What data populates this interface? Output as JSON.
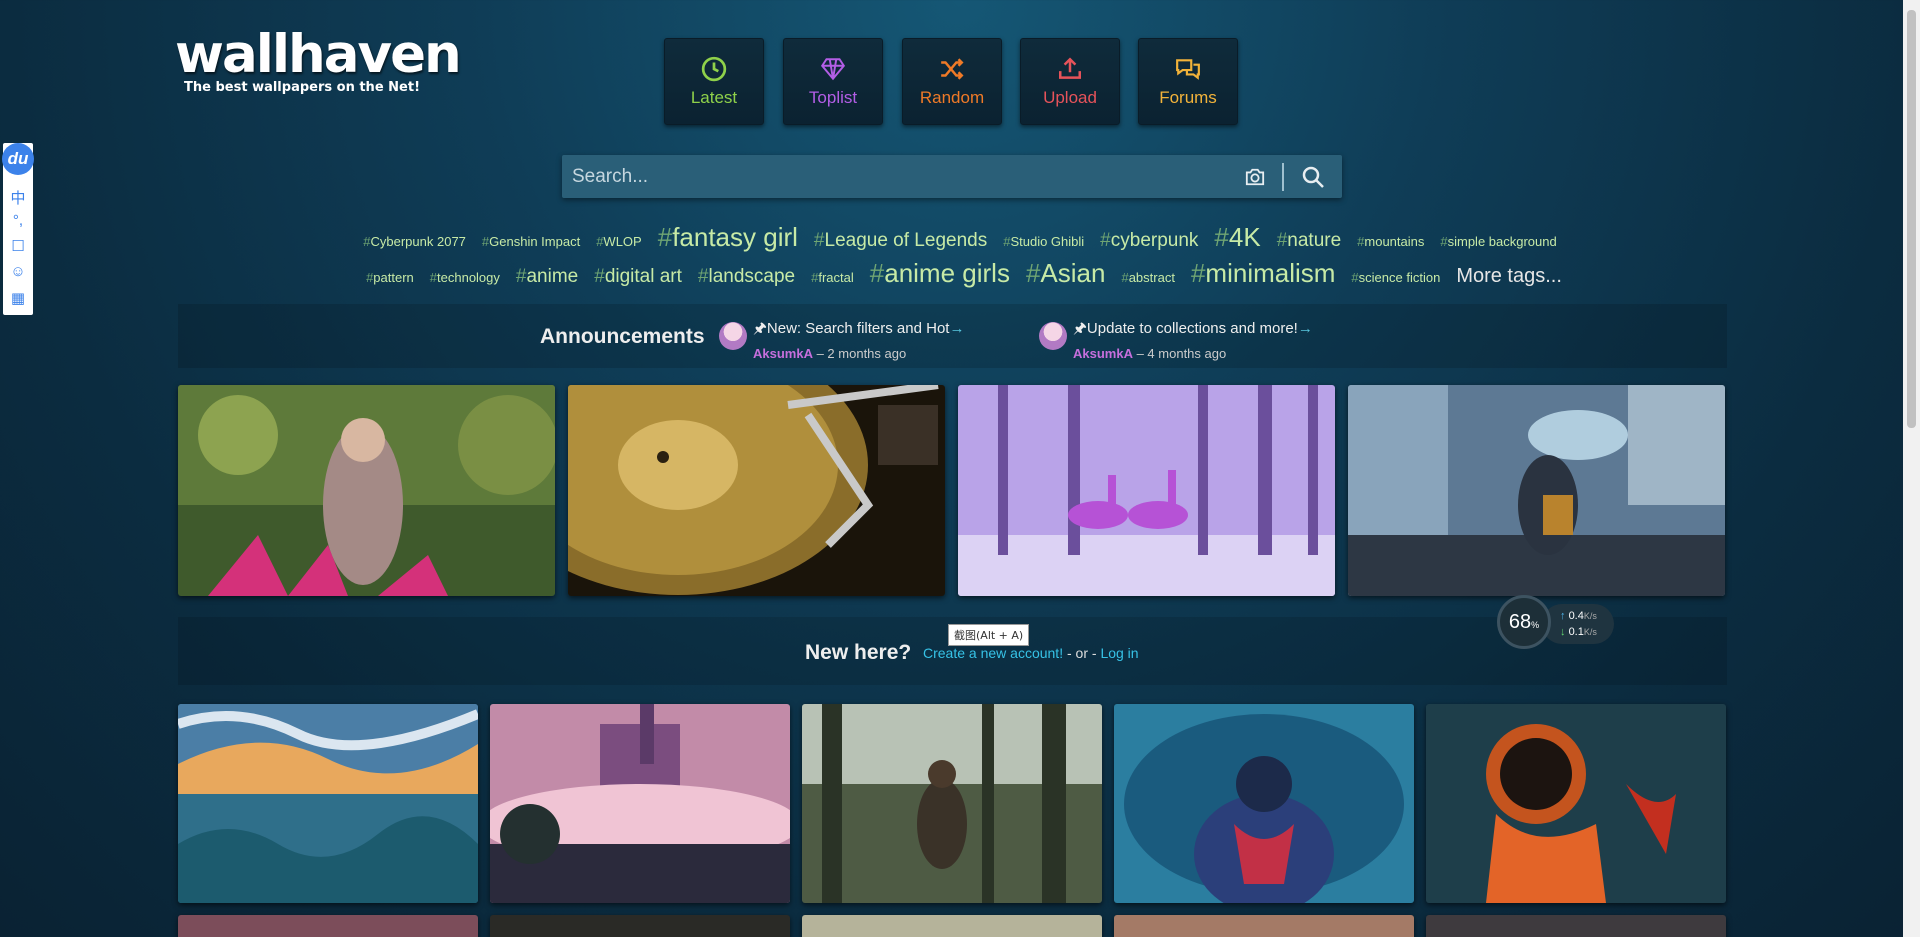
{
  "logo": {
    "title": "wallhaven",
    "tagline": "The best wallpapers on the Net!"
  },
  "nav": [
    {
      "label": "Latest",
      "icon": "clock-icon",
      "color": "#8fd14a"
    },
    {
      "label": "Toplist",
      "icon": "diamond-icon",
      "color": "#b35ee6"
    },
    {
      "label": "Random",
      "icon": "shuffle-icon",
      "color": "#ef7a27"
    },
    {
      "label": "Upload",
      "icon": "upload-icon",
      "color": "#e6535a"
    },
    {
      "label": "Forums",
      "icon": "comments-icon",
      "color": "#f2b33a"
    }
  ],
  "search": {
    "placeholder": "Search..."
  },
  "tags_row1": [
    {
      "name": "Cyberpunk 2077",
      "size": 1
    },
    {
      "name": "Genshin Impact",
      "size": 1
    },
    {
      "name": "WLOP",
      "size": 1
    },
    {
      "name": "fantasy girl",
      "size": 3
    },
    {
      "name": "League of Legends",
      "size": 2
    },
    {
      "name": "Studio Ghibli",
      "size": 1
    },
    {
      "name": "cyberpunk",
      "size": 2
    },
    {
      "name": "4K",
      "size": 3
    },
    {
      "name": "nature",
      "size": 2
    },
    {
      "name": "mountains",
      "size": 1
    },
    {
      "name": "simple background",
      "size": 1
    }
  ],
  "tags_row2": [
    {
      "name": "pattern",
      "size": 1
    },
    {
      "name": "technology",
      "size": 1
    },
    {
      "name": "anime",
      "size": 2
    },
    {
      "name": "digital art",
      "size": 2
    },
    {
      "name": "landscape",
      "size": 2
    },
    {
      "name": "fractal",
      "size": 1
    },
    {
      "name": "anime girls",
      "size": 3
    },
    {
      "name": "Asian",
      "size": 3
    },
    {
      "name": "abstract",
      "size": 1
    },
    {
      "name": "minimalism",
      "size": 3
    },
    {
      "name": "science fiction",
      "size": 1
    }
  ],
  "more_tags": "More tags...",
  "announcements": {
    "title": "Announcements",
    "items": [
      {
        "text": "New: Search filters and Hot",
        "user": "AksumkA",
        "ago": "– 2 months ago"
      },
      {
        "text": "Update to collections and more!",
        "user": "AksumkA",
        "ago": "– 4 months ago"
      }
    ]
  },
  "new_here": {
    "title": "New here?",
    "create": "Create a new account!",
    "or": " - or - ",
    "login": "Log in"
  },
  "tooltip": "截图(Alt + A)",
  "speed_widget": {
    "percent": "68",
    "percent_unit": "%",
    "up": "0.4",
    "down": "0.1",
    "unit": "K/s"
  },
  "ime": {
    "logo": "du",
    "items": [
      "中",
      "°,",
      "☐",
      "☺",
      "▦"
    ]
  },
  "thumbnails_top": [
    {
      "subject": "woman in garden with pink flowers"
    },
    {
      "subject": "gold vinyl record turntable"
    },
    {
      "subject": "purple deer in forest"
    },
    {
      "subject": "anime girl with umbrella in city"
    }
  ],
  "thumbnails_row2": [
    {
      "subject": "stylized ocean waves and sky"
    },
    {
      "subject": "fantasy city in pink clouds"
    },
    {
      "subject": "figure falling in forest"
    },
    {
      "subject": "person in blue smoke"
    },
    {
      "subject": "astronaut with fire"
    }
  ]
}
